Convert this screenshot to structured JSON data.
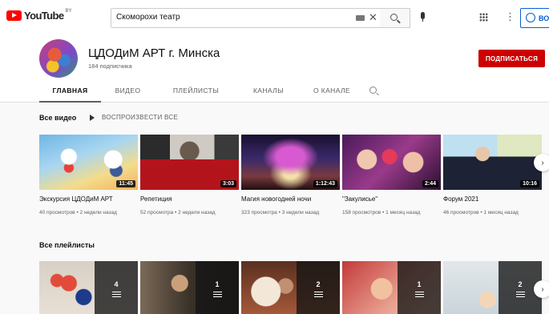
{
  "header": {
    "logo_text": "YouTube",
    "logo_region": "BY",
    "search_value": "Скоморохи театр",
    "signin_label": "ВО"
  },
  "channel": {
    "name": "ЦДОДиМ АРТ г. Минска",
    "subscribers": "184 подписчика",
    "subscribe_label": "ПОДПИСАТЬСЯ"
  },
  "tabs": [
    {
      "label": "ГЛАВНАЯ"
    },
    {
      "label": "ВИДЕО"
    },
    {
      "label": "ПЛЕЙЛИСТЫ"
    },
    {
      "label": "КАНАЛЫ"
    },
    {
      "label": "О КАНАЛЕ"
    }
  ],
  "videos_section": {
    "title": "Все видео",
    "play_all": "ВОСПРОИЗВЕСТИ ВСЕ",
    "items": [
      {
        "title": "Экскурсия ЦДОДиМ АРТ",
        "duration": "11:45",
        "meta": "40 просмотров • 2 недели назад"
      },
      {
        "title": "Репетиция",
        "duration": "3:03",
        "meta": "52 просмотра • 2 недели назад"
      },
      {
        "title": "Магия новогодней ночи",
        "duration": "1:12:43",
        "meta": "323 просмотра • 3 недели назад"
      },
      {
        "title": "\"Закулисье\"",
        "duration": "2:44",
        "meta": "158 просмотров • 1 месяц назад"
      },
      {
        "title": "Форум 2021",
        "duration": "10:16",
        "meta": "46 просмотров • 1 месяц назад"
      }
    ]
  },
  "playlists_section": {
    "title": "Все плейлисты",
    "items": [
      {
        "count": "4"
      },
      {
        "count": "1"
      },
      {
        "count": "2"
      },
      {
        "count": "1"
      },
      {
        "count": "2"
      }
    ]
  },
  "colors": {
    "brand_red": "#ff0000",
    "subscribe_red": "#cc0000",
    "link_blue": "#065fd4"
  }
}
